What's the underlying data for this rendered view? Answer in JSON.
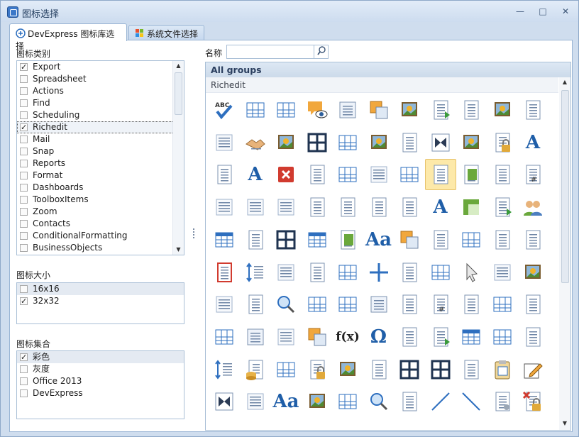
{
  "window": {
    "title": "图标选择",
    "minimize": "—",
    "maximize": "□",
    "close": "✕"
  },
  "tabs": [
    {
      "label": "DevExpress 图标库选择",
      "active": true
    },
    {
      "label": "系统文件选择",
      "active": false
    }
  ],
  "left": {
    "category_label": "图标类别",
    "categories": [
      {
        "label": "Export",
        "checked": true
      },
      {
        "label": "Spreadsheet",
        "checked": false
      },
      {
        "label": "Actions",
        "checked": false
      },
      {
        "label": "Find",
        "checked": false
      },
      {
        "label": "Scheduling",
        "checked": false
      },
      {
        "label": "Richedit",
        "checked": true,
        "selected": true
      },
      {
        "label": "Mail",
        "checked": false
      },
      {
        "label": "Snap",
        "checked": false
      },
      {
        "label": "Reports",
        "checked": false
      },
      {
        "label": "Format",
        "checked": false
      },
      {
        "label": "Dashboards",
        "checked": false
      },
      {
        "label": "ToolboxItems",
        "checked": false
      },
      {
        "label": "Zoom",
        "checked": false
      },
      {
        "label": "Contacts",
        "checked": false
      },
      {
        "label": "ConditionalFormatting",
        "checked": false
      },
      {
        "label": "BusinessObjects",
        "checked": false
      }
    ],
    "size_label": "图标大小",
    "sizes": [
      {
        "label": "16x16",
        "checked": false
      },
      {
        "label": "32x32",
        "checked": true
      }
    ],
    "set_label": "图标集合",
    "sets": [
      {
        "label": "彩色",
        "checked": true
      },
      {
        "label": "灰度",
        "checked": false
      },
      {
        "label": "Office 2013",
        "checked": false
      },
      {
        "label": "DevExpress",
        "checked": false
      }
    ]
  },
  "search": {
    "label": "名称",
    "value": "",
    "placeholder": ""
  },
  "gallery": {
    "all_groups": "All groups",
    "group": "Richedit",
    "highlighted_index": 29,
    "icons": [
      "spelling-icon",
      "table-icon",
      "table-grid-icon",
      "comment-eye-icon",
      "formula-table-icon",
      "bring-front-icon",
      "picture-icon",
      "page-arrow-icon",
      "page-text-icon",
      "picture2-icon",
      "abc-ab-icon",
      "indent-arrow-icon",
      "handshake-icon",
      "page-picture-icon",
      "table-2x2-icon",
      "table-border-icon",
      "page-picture2-icon",
      "page-eraser-icon",
      "bookmark-butterfly-icon",
      "page-picture3-icon",
      "user-lock-icon",
      "font-color-icon",
      "page-lines-icon",
      "font-a-icon",
      "delete-icon",
      "page-border-icon",
      "table-pencil-icon",
      "insert-row-icon",
      "table-corner-icon",
      "page-blank-icon",
      "page-stack-highlight-icon",
      "eraser-ab-icon",
      "page-hash-icon",
      "align-left-icon",
      "align-center-icon",
      "align-justify-icon",
      "page-move-icon",
      "page-scroll-icon",
      "page-frame-icon",
      "page-lines2-icon",
      "text-a-icon",
      "shading-icon",
      "page-arrow2-icon",
      "users-icon",
      "table-header-icon",
      "page-fold-icon",
      "table-4-icon",
      "table-header2-icon",
      "pages-stack-icon",
      "text-aa-icon",
      "send-back-icon",
      "page-img-icon",
      "table-columns-icon",
      "page-pic-icon",
      "page-refresh-icon",
      "page-red-icon",
      "line-spacing-icon",
      "list-red-icon",
      "abc-page-icon",
      "table-merge-icon",
      "cross-lines-icon",
      "page-text2-icon",
      "table-lines-icon",
      "cursor-icon",
      "align-right-icon",
      "page-picture4-icon",
      "indent-list-icon",
      "page-center-icon",
      "search-globe-icon",
      "table-cell-icon",
      "table-split-icon",
      "bookmark-page-icon",
      "page-curve-icon",
      "page-hash2-icon",
      "page-list-icon",
      "table-delete-row-icon",
      "page-right-icon",
      "table-col-icon",
      "select-frame-icon",
      "insert-column-icon",
      "copy-shapes-icon",
      "fx-icon",
      "omega-icon",
      "page-swap-icon",
      "page-play-icon",
      "table-blue-icon",
      "table-eraser-icon",
      "page-scroll2-icon",
      "sort-icon",
      "database-page-icon",
      "table-dims-icon",
      "lock-page-icon",
      "image-icon",
      "page-import-icon",
      "table-big-icon",
      "table-split2-icon",
      "page-align-icon",
      "clipboard-icon",
      "edit-icon",
      "butterfly-icon",
      "insert-table-icon",
      "font-aa-icon",
      "picture-frame-icon",
      "table-delete-icon",
      "page-search-icon",
      "page-text3-icon",
      "diagonal-icon",
      "diagonal2-icon",
      "page-gear-icon",
      "lock-delete-icon"
    ]
  },
  "colors": {
    "accent": "#2e6fbf",
    "header": "#dde8f4",
    "highlight": "#fde9a9",
    "red": "#d13b2f",
    "green": "#6aa83c"
  }
}
